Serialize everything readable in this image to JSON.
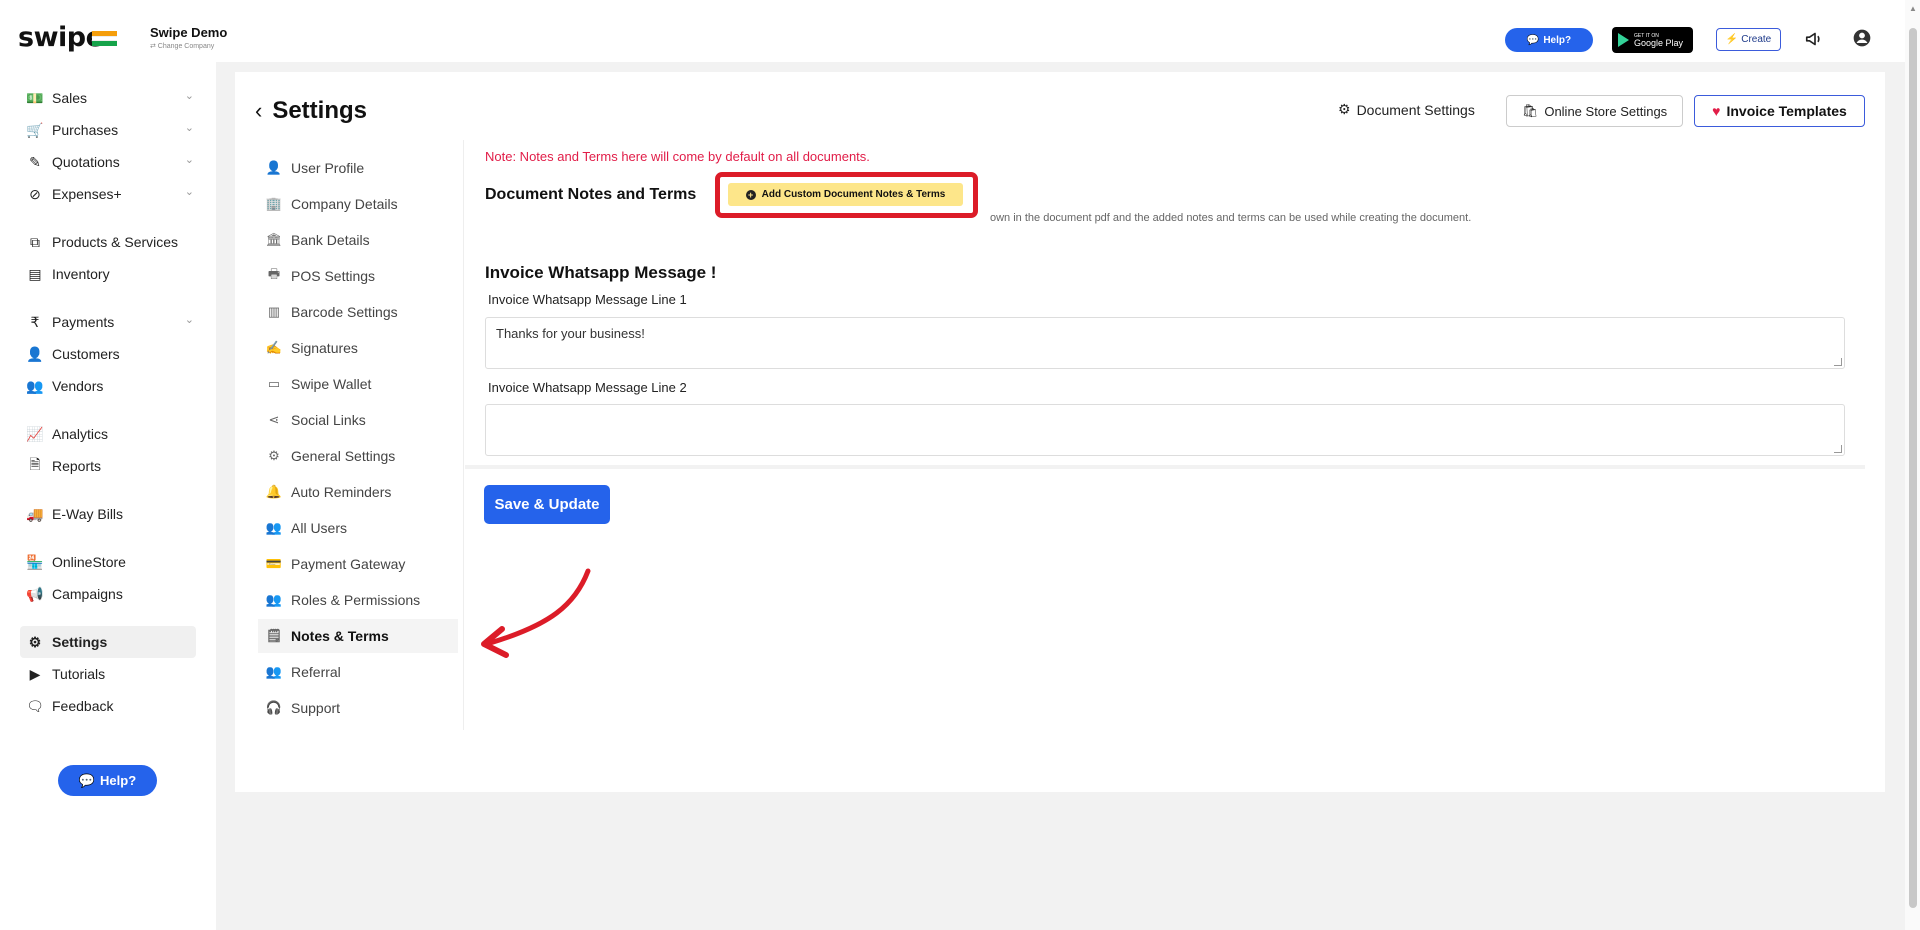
{
  "header": {
    "logo": "swipe",
    "company_name": "Swipe Demo",
    "change_company": "⇄ Change Company",
    "help_label": "Help?",
    "gplay_small": "GET IT ON",
    "gplay_label": "Google Play",
    "create_label": "Create"
  },
  "sidebar": {
    "items": [
      {
        "label": "Sales",
        "icon": "cash-icon"
      },
      {
        "label": "Purchases",
        "icon": "cart-icon"
      },
      {
        "label": "Quotations",
        "icon": "pen-icon"
      },
      {
        "label": "Expenses+",
        "icon": "tag-icon"
      },
      {
        "label": "Products & Services",
        "icon": "box-icon"
      },
      {
        "label": "Inventory",
        "icon": "warehouse-icon"
      },
      {
        "label": "Payments",
        "icon": "rupee-icon"
      },
      {
        "label": "Customers",
        "icon": "user-icon"
      },
      {
        "label": "Vendors",
        "icon": "users-icon"
      },
      {
        "label": "Analytics",
        "icon": "chart-icon"
      },
      {
        "label": "Reports",
        "icon": "report-icon"
      },
      {
        "label": "E-Way Bills",
        "icon": "truck-icon"
      },
      {
        "label": "OnlineStore",
        "icon": "store-icon"
      },
      {
        "label": "Campaigns",
        "icon": "megaphone-icon"
      },
      {
        "label": "Settings",
        "icon": "gear-icon"
      },
      {
        "label": "Tutorials",
        "icon": "youtube-icon"
      },
      {
        "label": "Feedback",
        "icon": "chat-icon"
      }
    ],
    "help_label": "Help?"
  },
  "page": {
    "title": "Settings",
    "doc_settings": "Document Settings",
    "store_settings": "Online Store Settings",
    "invoice_templates": "Invoice Templates"
  },
  "submenu": {
    "items": [
      "User Profile",
      "Company Details",
      "Bank Details",
      "POS Settings",
      "Barcode Settings",
      "Signatures",
      "Swipe Wallet",
      "Social Links",
      "General Settings",
      "Auto Reminders",
      "All Users",
      "Payment Gateway",
      "Roles & Permissions",
      "Notes & Terms",
      "Referral",
      "Support"
    ],
    "active": "Notes & Terms"
  },
  "content": {
    "note": "Note: Notes and Terms here will come by default on all documents.",
    "section_title": "Document Notes and Terms",
    "add_custom_label": "Add Custom Document Notes & Terms",
    "section_desc": "own in the document pdf and the added notes and terms can be used while creating the document.",
    "wa_title": "Invoice Whatsapp Message !",
    "line1_label": "Invoice Whatsapp Message Line 1",
    "line1_value": "Thanks for your business!",
    "line2_label": "Invoice Whatsapp Message Line 2",
    "line2_value": "",
    "save_label": "Save & Update"
  },
  "colors": {
    "accent": "#2563eb",
    "highlight": "#dc1c28",
    "note": "#e11d48",
    "add_button_bg": "#fde68a"
  }
}
